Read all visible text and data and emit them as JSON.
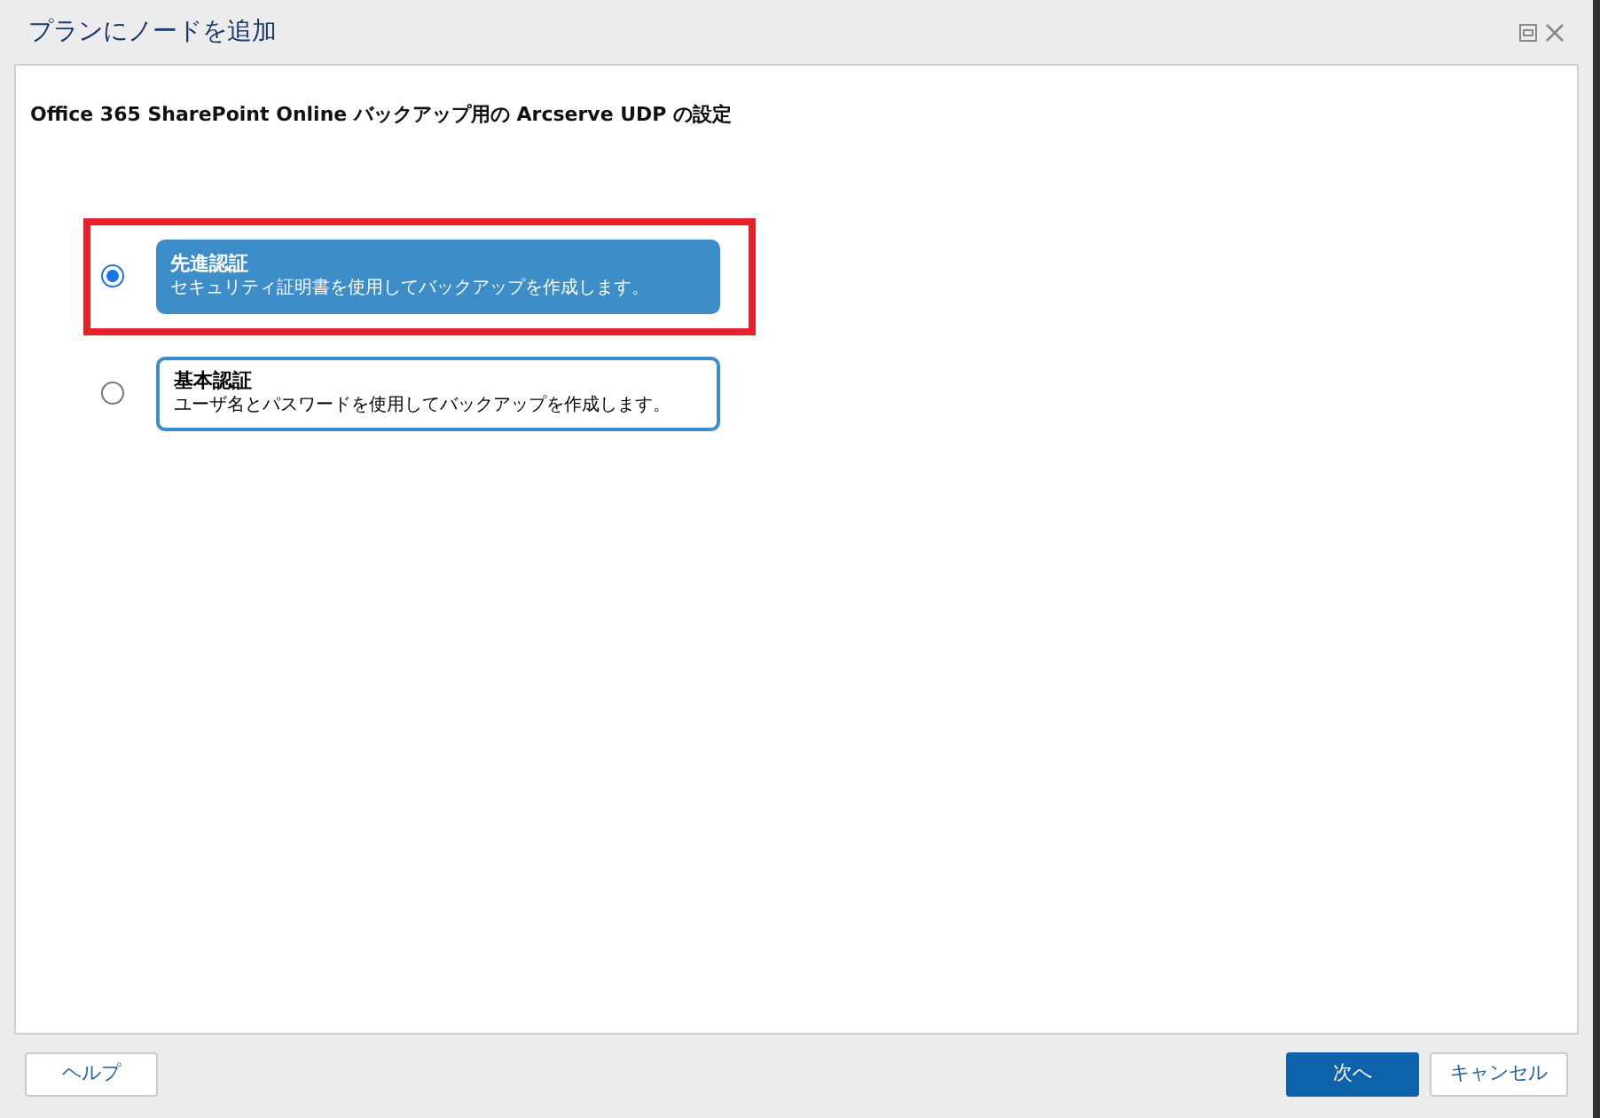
{
  "window": {
    "title": "プランにノードを追加"
  },
  "heading": "Office 365 SharePoint Online バックアップ用の Arcserve UDP の設定",
  "options": [
    {
      "title": "先進認証",
      "description": "セキュリティ証明書を使用してバックアップを作成します。",
      "selected": true
    },
    {
      "title": "基本認証",
      "description": "ユーザ名とパスワードを使用してバックアップを作成します。",
      "selected": false
    }
  ],
  "buttons": {
    "help": "ヘルプ",
    "next": "次へ",
    "cancel": "キャンセル"
  }
}
